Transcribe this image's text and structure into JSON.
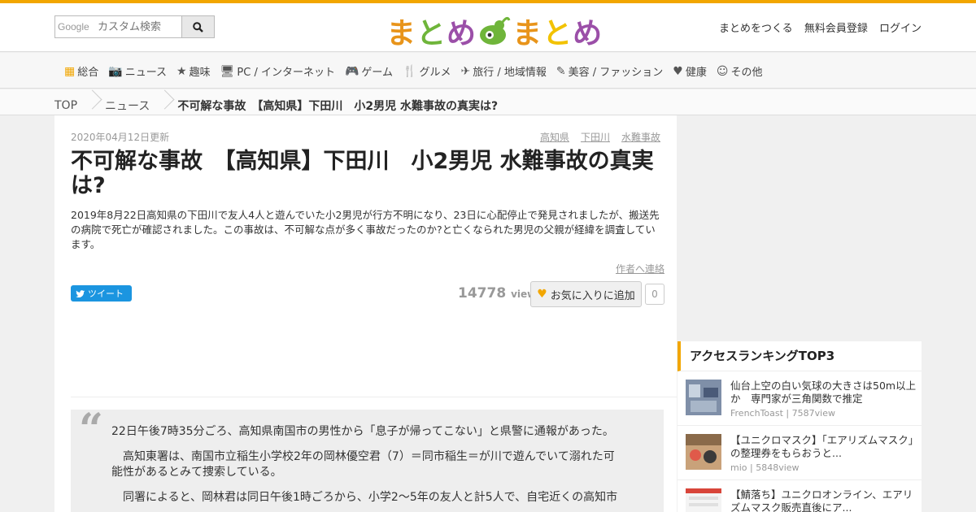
{
  "header": {
    "search_brand": "Google",
    "search_placeholder": "カスタム検索",
    "logo_chars": [
      "ま",
      "と",
      "め",
      "ま",
      "と",
      "め"
    ],
    "logo_colors": [
      "#e8941a",
      "#6fb53a",
      "#9b4fa8",
      "#e8941a",
      "#f2c200",
      "#9b4fa8"
    ],
    "links": [
      "まとめをつくる",
      "無料会員登録",
      "ログイン"
    ]
  },
  "nav": {
    "items": [
      {
        "icon": "grid-icon",
        "glyph": "▦",
        "label": "総合"
      },
      {
        "icon": "camera-icon",
        "glyph": "📷",
        "label": "ニュース"
      },
      {
        "icon": "star-icon",
        "glyph": "★",
        "label": "趣味"
      },
      {
        "icon": "monitor-icon",
        "glyph": "🖥",
        "label": "PC / インターネット"
      },
      {
        "icon": "gamepad-icon",
        "glyph": "🎮",
        "label": "ゲーム"
      },
      {
        "icon": "cutlery-icon",
        "glyph": "🍴",
        "label": "グルメ"
      },
      {
        "icon": "plane-icon",
        "glyph": "✈",
        "label": "旅行 / 地域情報"
      },
      {
        "icon": "pen-icon",
        "glyph": "✎",
        "label": "美容 / ファッション"
      },
      {
        "icon": "heartbeat-icon",
        "glyph": "♥",
        "label": "健康"
      },
      {
        "icon": "other-icon",
        "glyph": "☺",
        "label": "その他"
      }
    ]
  },
  "breadcrumb": {
    "items": [
      "TOP",
      "ニュース"
    ],
    "current": "不可解な事故　【高知県】下田川　小2男児 水難事故の真実は?"
  },
  "article": {
    "updated": "2020年04月12日更新",
    "tags": [
      "高知県",
      "下田川",
      "水難事故"
    ],
    "title": "不可解な事故　【高知県】下田川　小2男児 水難事故の真実は?",
    "description": "2019年8月22日高知県の下田川で友人4人と遊んでいた小2男児が行方不明になり、23日に心配停止で発見されましたが、搬送先の病院で死亡が確認されました。この事故は、不可解な点が多く事故だったのか?と亡くなられた男児の父親が経緯を調査しています。",
    "contact_label": "作者へ連絡",
    "tweet_label": "ツイート",
    "views": "14778",
    "views_unit": "view",
    "fav_label": "お気に入りに追加",
    "fav_count": "0",
    "quote": [
      "22日午後7時35分ごろ、高知県南国市の男性から「息子が帰ってこない」と県警に通報があった。",
      "　高知東署は、南国市立稲生小学校2年の岡林優空君（7）＝同市稲生＝が川で遊んでいて溺れた可能性があるとみて捜索している。",
      "　同署によると、岡林君は同日午後1時ごろから、小学2～5年の友人と計5人で、自宅近くの高知市"
    ]
  },
  "sidebar": {
    "title": "アクセスランキングTOP3",
    "items": [
      {
        "title": "仙台上空の白い気球の大きさは50m以上か　専門家が三角関数で推定",
        "meta": "FrenchToast | 7587view"
      },
      {
        "title": "【ユニクロマスク】「エアリズムマスク」の整理券をもらおうと...",
        "meta": "mio | 5848view"
      },
      {
        "title": "【鯖落ち】ユニクロオンライン、エアリズムマスク販売直後にア...",
        "meta": ""
      }
    ]
  }
}
